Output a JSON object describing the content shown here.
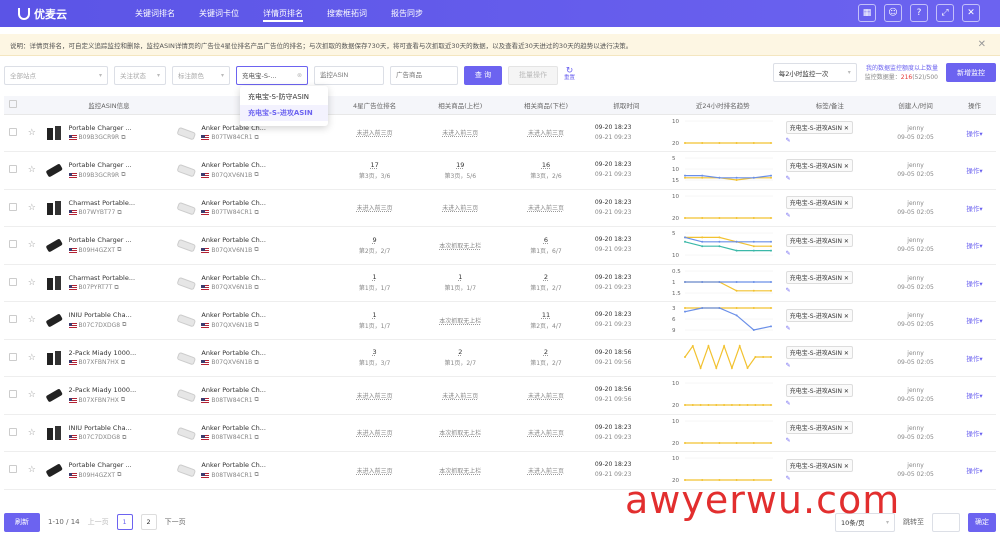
{
  "app": {
    "name": "优麦云"
  },
  "nav": [
    {
      "label": "关键词排名",
      "active": false
    },
    {
      "label": "关键词卡位",
      "active": false
    },
    {
      "label": "详情页排名",
      "active": true
    },
    {
      "label": "搜索框拓词",
      "active": false
    },
    {
      "label": "报告同步",
      "active": false
    }
  ],
  "notice": {
    "text": "说明：详情页排名，可自定义追踪监控和删除，监控ASIN详情页的广告位4星位排名产品广告位的排名；与次抓取的数据保存730天，将可查看与次抓取近30天的数据，以及查看近30天进过的30天的趋势以进行决策。"
  },
  "filters": {
    "site": "全部站点",
    "status": "关注状态",
    "color": "标注颜色",
    "group": "充电宝-S-...",
    "asin_placeholder": "监控ASIN",
    "ad_placeholder": "广告商品",
    "search_label": "查 询",
    "batch_label": "批量操作",
    "reset_label": "重置",
    "frequency": "每2小时监控一次",
    "quota_line1": "我的数据监控额度以上数量",
    "quota_line2_prefix": "监控数据量：",
    "quota_value": "216",
    "quota_suffix": "(52)/500",
    "add_label": "新增监控"
  },
  "dropdown": {
    "items": [
      "充电宝-S-防守ASIN",
      "充电宝-S-进攻ASIN"
    ],
    "selected": 1
  },
  "table": {
    "headers": [
      "监控ASIN信息",
      "广告商品",
      "4星广告位排名",
      "相关商品(上栏)",
      "相关商品(下栏)",
      "抓取时间",
      "近24小时排名趋势",
      "标签/备注",
      "创建人/时间",
      "操作"
    ],
    "rows": [
      {
        "title": "Portable Charger ...",
        "asin": "B09B3GCR9R",
        "ad_title": "Anker Portable Ch...",
        "ad_asin": "B07TW84CR1",
        "r1": "未进入前三页",
        "r1s": "",
        "r2": "未进入前三页",
        "r2s": "",
        "r3": "未进入前三页",
        "r3s": "",
        "t1": "09-20 18:23",
        "t2": "09-21 09:23",
        "tag": "充电宝-S-进攻ASIN",
        "user": "jenny",
        "date": "09-05 02:05",
        "op": "操作",
        "y": [
          10,
          20
        ],
        "trend": [
          [
            20,
            20,
            20,
            20,
            20,
            20
          ]
        ]
      },
      {
        "title": "Portable Charger ...",
        "asin": "B09B3GCR9R",
        "ad_title": "Anker Portable Ch...",
        "ad_asin": "B07QXV6N1B",
        "r1": "17",
        "r1s": "第3页，3/6",
        "r2": "19",
        "r2s": "第3页，5/6",
        "r3": "16",
        "r3s": "第3页，2/6",
        "t1": "09-20 18:23",
        "t2": "09-21 09:23",
        "tag": "充电宝-S-进攻ASIN",
        "user": "jenny",
        "date": "09-05 02:05",
        "op": "操作",
        "y": [
          5,
          10,
          15
        ],
        "trend": [
          [
            14,
            14,
            14,
            15,
            14,
            14
          ],
          [
            13,
            13,
            14,
            14,
            14,
            13
          ]
        ]
      },
      {
        "title": "Charmast Portable...",
        "asin": "B07WYBT77",
        "ad_title": "Anker Portable Ch...",
        "ad_asin": "B07TW84CR1",
        "r1": "未进入前三页",
        "r1s": "",
        "r2": "未进入前三页",
        "r2s": "",
        "r3": "未进入前三页",
        "r3s": "",
        "t1": "09-20 18:23",
        "t2": "09-21 09:23",
        "tag": "充电宝-S-进攻ASIN",
        "user": "jenny",
        "date": "09-05 02:05",
        "op": "操作",
        "y": [
          10,
          20
        ],
        "trend": [
          [
            20,
            20,
            20,
            20,
            20,
            20
          ]
        ]
      },
      {
        "title": "Portable Charger ...",
        "asin": "B09H4GZXT",
        "ad_title": "Anker Portable Ch...",
        "ad_asin": "B07QXV6N1B",
        "r1": "9",
        "r1s": "第2页，2/7",
        "r2": "本次抓取无上栏",
        "r2s": "",
        "r3": "6",
        "r3s": "第1页，6/7",
        "t1": "09-20 18:23",
        "t2": "09-21 09:23",
        "tag": "充电宝-S-进攻ASIN",
        "user": "jenny",
        "date": "09-05 02:05",
        "op": "操作",
        "y": [
          5,
          10
        ],
        "trend": [
          [
            6,
            6,
            6,
            7,
            8,
            8
          ],
          [
            6,
            7,
            7,
            7,
            7,
            7
          ],
          [
            7,
            8,
            8,
            9,
            9,
            9
          ]
        ]
      },
      {
        "title": "Charmast Portable...",
        "asin": "B07PYRT7T",
        "ad_title": "Anker Portable Ch...",
        "ad_asin": "B07QXV6N1B",
        "r1": "1",
        "r1s": "第1页，1/7",
        "r2": "1",
        "r2s": "第1页，1/7",
        "r3": "2",
        "r3s": "第1页，2/7",
        "t1": "09-20 18:23",
        "t2": "09-21 09:23",
        "tag": "充电宝-S-进攻ASIN",
        "user": "jenny",
        "date": "09-05 02:05",
        "op": "操作",
        "y": [
          0.5,
          1,
          1.5
        ],
        "trend": [
          [
            1,
            1,
            1,
            1.4,
            1.4,
            1.4
          ],
          [
            1,
            1,
            1,
            1,
            1,
            1
          ]
        ]
      },
      {
        "title": "INIU Portable Cha...",
        "asin": "B07C7DXDG8",
        "ad_title": "Anker Portable Ch...",
        "ad_asin": "B07QXV6N1B",
        "r1": "1",
        "r1s": "第1页，1/7",
        "r2": "本次抓取无上栏",
        "r2s": "",
        "r3": "11",
        "r3s": "第2页，4/7",
        "t1": "09-20 18:23",
        "t2": "09-21 09:23",
        "tag": "充电宝-S-进攻ASIN",
        "user": "jenny",
        "date": "09-05 02:05",
        "op": "操作",
        "y": [
          3,
          6,
          9
        ],
        "trend": [
          [
            3,
            3,
            3,
            3,
            3,
            3
          ],
          [
            4,
            3,
            3,
            5,
            9,
            8
          ]
        ]
      },
      {
        "title": "2-Pack Miady 1000...",
        "asin": "B07XFBN7HX",
        "ad_title": "Anker Portable Ch...",
        "ad_asin": "B07QXV6N1B",
        "r1": "3",
        "r1s": "第1页，3/7",
        "r2": "2",
        "r2s": "第1页，2/7",
        "r3": "2",
        "r3s": "第1页，2/7",
        "t1": "09-20 18:56",
        "t2": "09-21 09:56",
        "tag": "充电宝-S-进攻ASIN",
        "user": "jenny",
        "date": "09-05 02:05",
        "op": "操作",
        "y": [],
        "trend": [
          [
            2,
            1,
            3,
            1,
            3,
            1,
            3,
            1,
            3,
            2,
            2,
            2
          ]
        ]
      },
      {
        "title": "2-Pack Miady 1000...",
        "asin": "B07XFBN7HX",
        "ad_title": "Anker Portable Ch...",
        "ad_asin": "B08TW84CR1",
        "r1": "未进入前三页",
        "r1s": "",
        "r2": "未进入前三页",
        "r2s": "",
        "r3": "未进入前三页",
        "r3s": "",
        "t1": "09-20 18:56",
        "t2": "09-21 09:56",
        "tag": "充电宝-S-进攻ASIN",
        "user": "jenny",
        "date": "09-05 02:05",
        "op": "操作",
        "y": [
          10,
          20
        ],
        "trend": [
          [
            20,
            20,
            20,
            20,
            20,
            20,
            20,
            20,
            20,
            20,
            20,
            20
          ]
        ]
      },
      {
        "title": "INIU Portable Cha...",
        "asin": "B07C7DXDG8",
        "ad_title": "Anker Portable Ch...",
        "ad_asin": "B08TW84CR1",
        "r1": "未进入前三页",
        "r1s": "",
        "r2": "本次抓取无上栏",
        "r2s": "",
        "r3": "未进入前三页",
        "r3s": "",
        "t1": "09-20 18:23",
        "t2": "09-21 09:23",
        "tag": "充电宝-S-进攻ASIN",
        "user": "jenny",
        "date": "09-05 02:05",
        "op": "操作",
        "y": [
          10,
          20
        ],
        "trend": [
          [
            20,
            20,
            20,
            20,
            20,
            20
          ]
        ]
      },
      {
        "title": "Portable Charger ...",
        "asin": "B09H4GZXT",
        "ad_title": "Anker Portable Ch...",
        "ad_asin": "B08TW84CR1",
        "r1": "未进入前三页",
        "r1s": "",
        "r2": "本次抓取无上栏",
        "r2s": "",
        "r3": "未进入前三页",
        "r3s": "",
        "t1": "09-20 18:23",
        "t2": "09-21 09:23",
        "tag": "充电宝-S-进攻ASIN",
        "user": "jenny",
        "date": "09-05 02:05",
        "op": "操作",
        "y": [
          10,
          20
        ],
        "trend": [
          [
            20,
            20,
            20,
            20,
            20,
            20
          ]
        ]
      }
    ]
  },
  "colors": {
    "accent": "#6c63f0",
    "line_blue": "#6a8fe8",
    "line_yellow": "#f2c230",
    "line_teal": "#3bb8a8"
  },
  "pagination": {
    "refresh": "刷新",
    "summary": "1-10 / 14",
    "prev": "上一页",
    "pages": [
      "1",
      "2"
    ],
    "next": "下一页",
    "page_size": "10条/页",
    "jump_label": "跳转至",
    "confirm": "确定"
  },
  "watermark": "awyerwu.com"
}
